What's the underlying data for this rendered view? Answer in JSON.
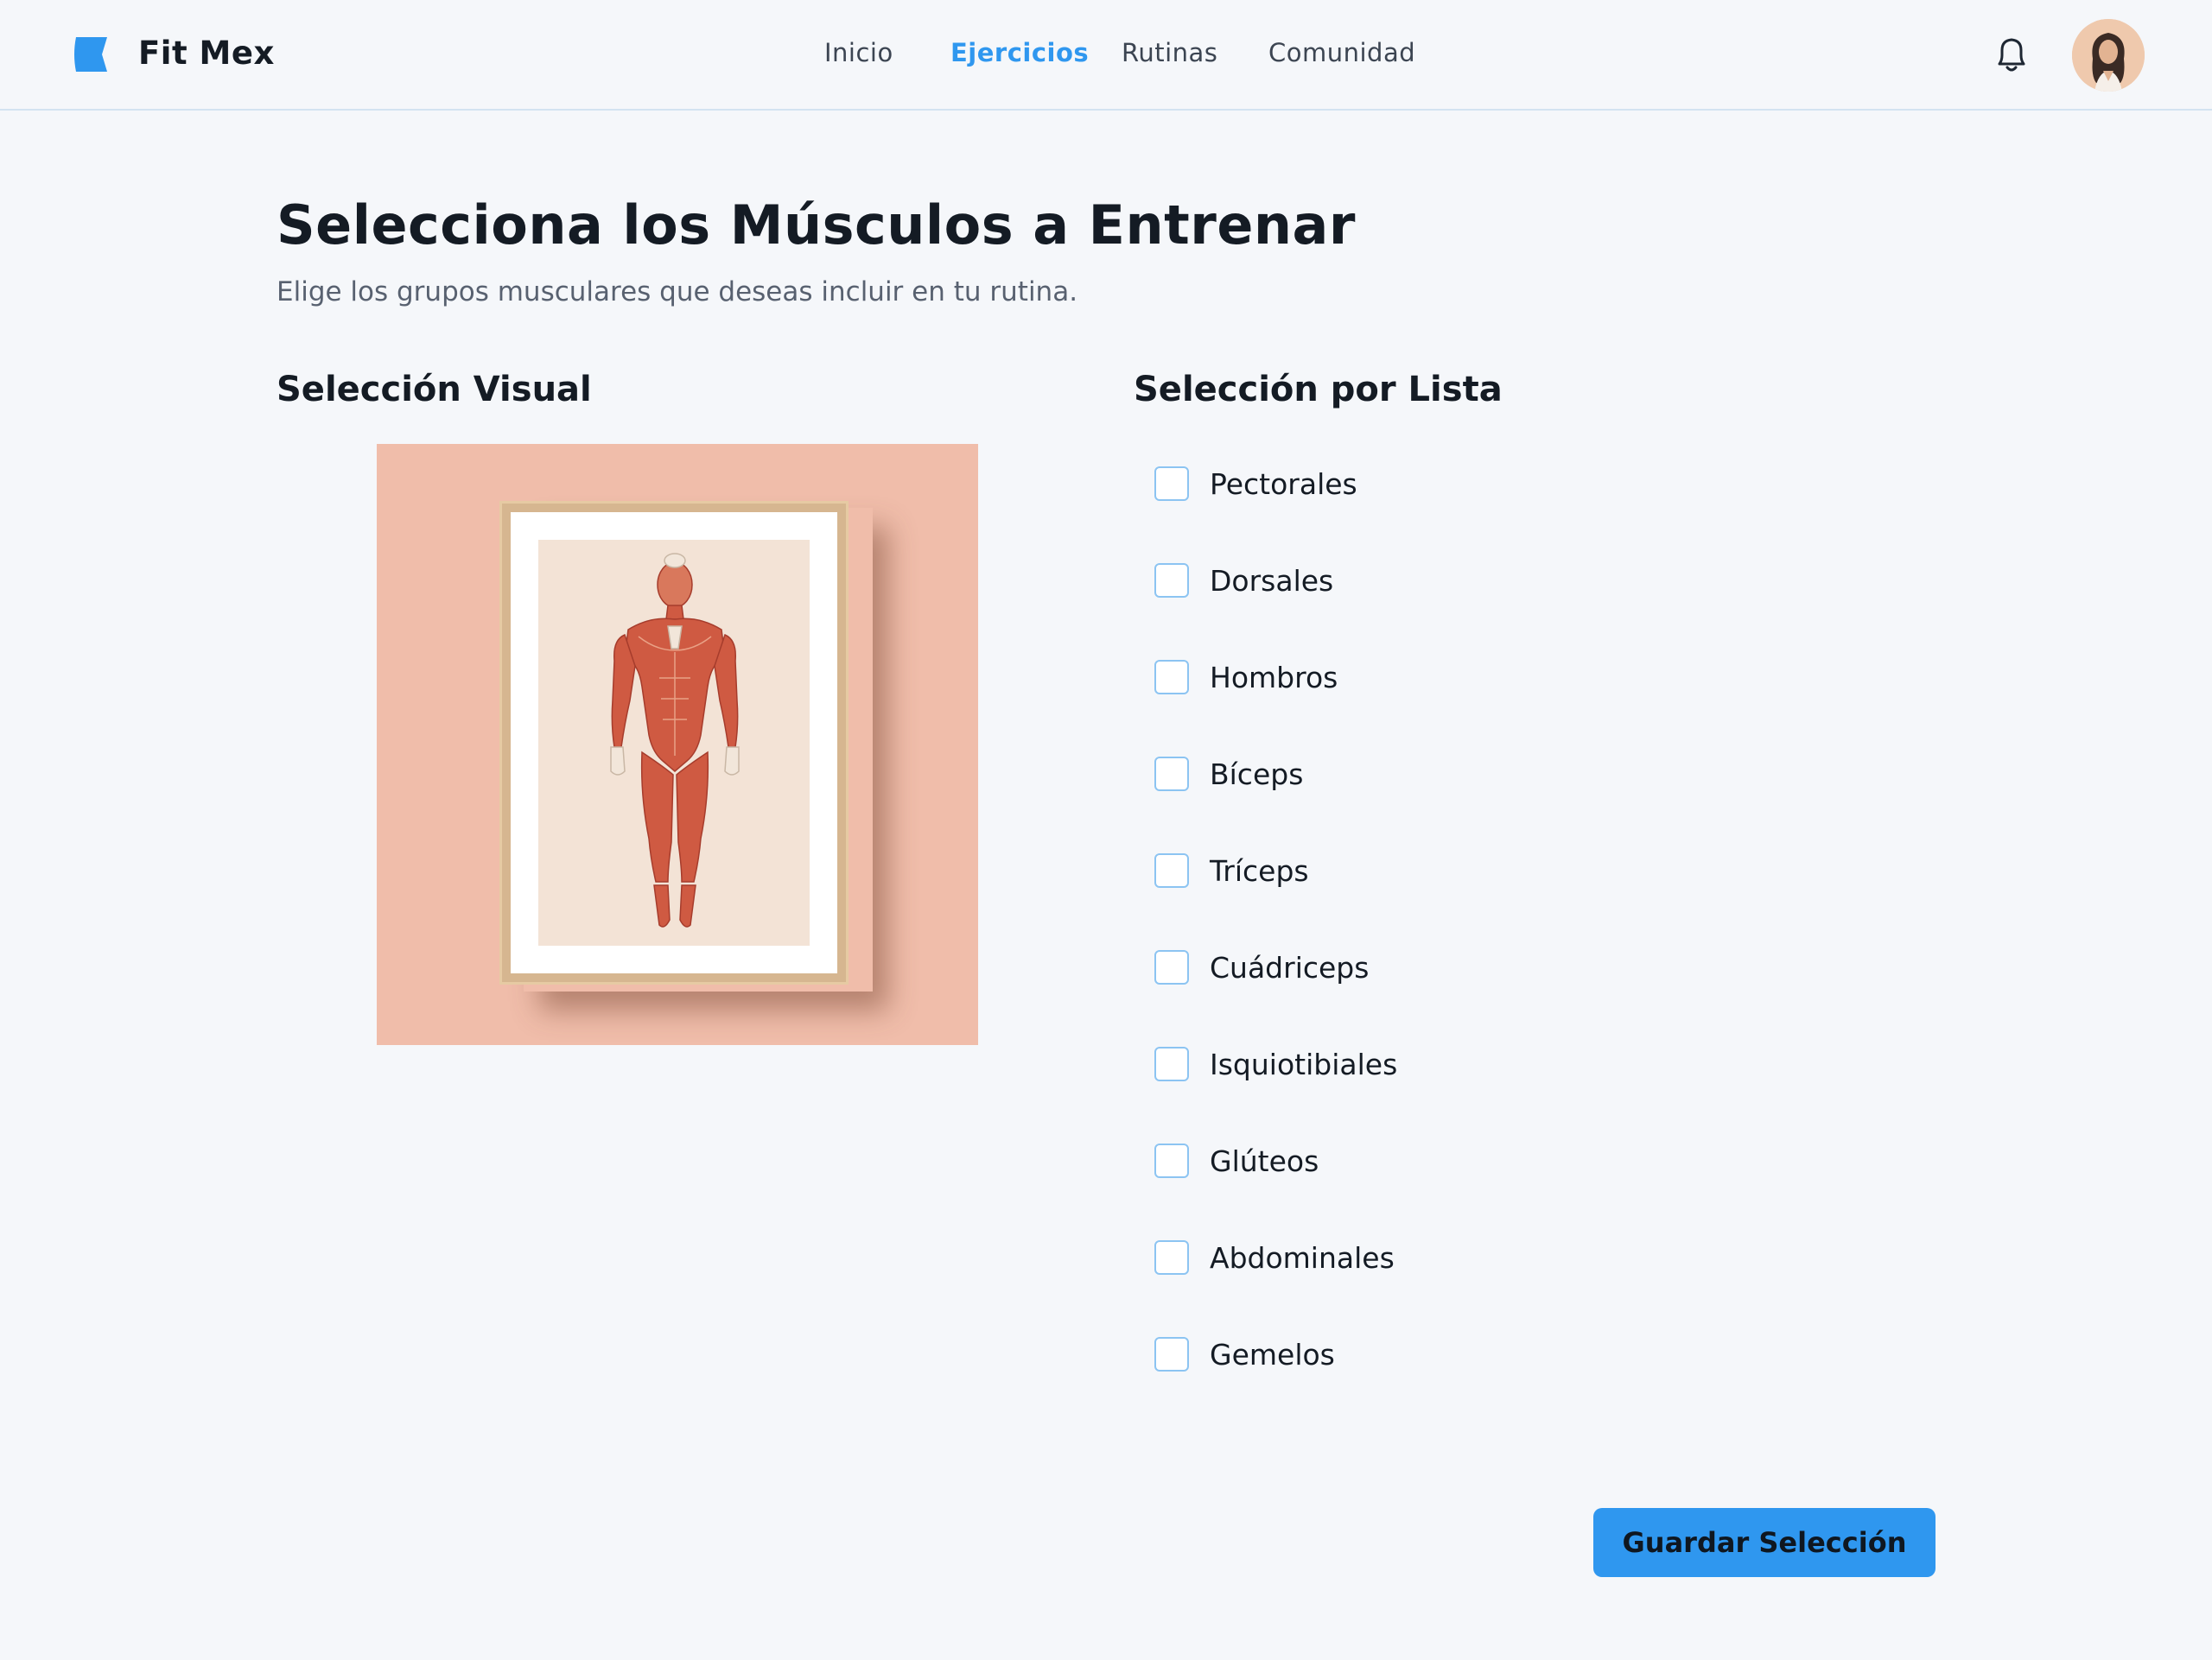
{
  "app": {
    "name": "Fit Mex"
  },
  "nav": {
    "items": [
      {
        "label": "Inicio",
        "active": false
      },
      {
        "label": "Ejercicios",
        "active": true
      },
      {
        "label": "Rutinas",
        "active": false
      },
      {
        "label": "Comunidad",
        "active": false
      }
    ]
  },
  "header": {
    "notification_icon": "bell-icon",
    "avatar_icon": "user-avatar"
  },
  "page": {
    "title": "Selecciona los Músculos a Entrenar",
    "subtitle": "Elige los grupos musculares que deseas incluir en tu rutina."
  },
  "visual": {
    "title": "Selección Visual",
    "image_subject": "anatomy-poster"
  },
  "list": {
    "title": "Selección por Lista",
    "items": [
      {
        "label": "Pectorales",
        "checked": false
      },
      {
        "label": "Dorsales",
        "checked": false
      },
      {
        "label": "Hombros",
        "checked": false
      },
      {
        "label": "Bíceps",
        "checked": false
      },
      {
        "label": "Tríceps",
        "checked": false
      },
      {
        "label": "Cuádriceps",
        "checked": false
      },
      {
        "label": "Isquiotibiales",
        "checked": false
      },
      {
        "label": "Glúteos",
        "checked": false
      },
      {
        "label": "Abdominales",
        "checked": false
      },
      {
        "label": "Gemelos",
        "checked": false
      }
    ]
  },
  "actions": {
    "save_label": "Guardar Selección"
  },
  "colors": {
    "accent": "#2f97ef",
    "background": "#f5f7fa",
    "panel": "#f0bdaa",
    "text": "#141b24",
    "checkbox_border": "#8cc4f2"
  }
}
